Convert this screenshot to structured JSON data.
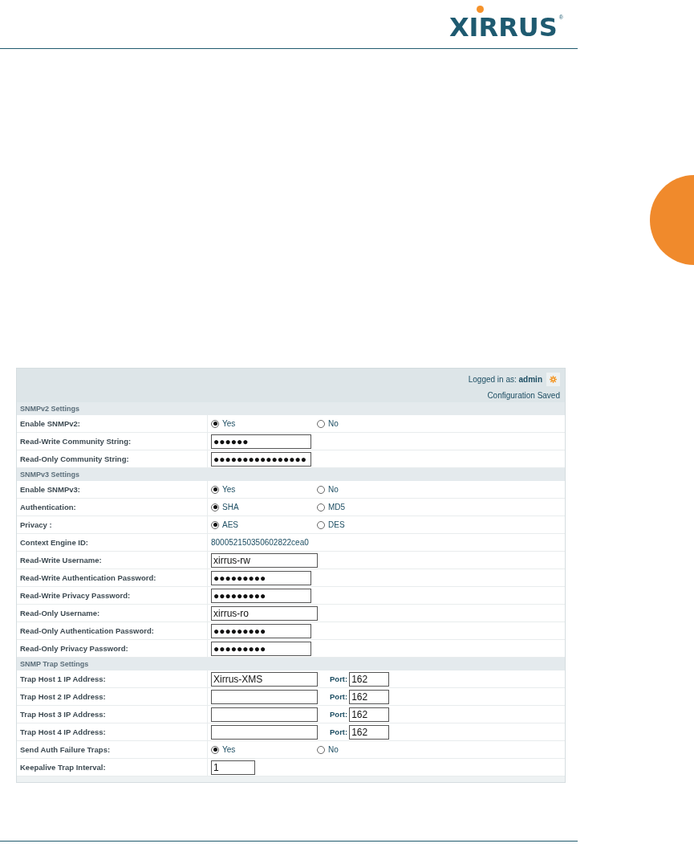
{
  "logo": {
    "text": "XIRRUS",
    "mark": "®"
  },
  "panel": {
    "login_label": "Logged in as:",
    "user": "admin",
    "status": "Configuration Saved"
  },
  "rows": [
    {
      "kind": "section",
      "label": "SNMPv2 Settings"
    },
    {
      "kind": "radio",
      "label": "Enable SNMPv2:",
      "options": [
        {
          "label": "Yes",
          "selected": true
        },
        {
          "label": "No",
          "selected": false
        }
      ]
    },
    {
      "kind": "password",
      "label": "Read-Write Community String:",
      "value": "●●●●●●"
    },
    {
      "kind": "password",
      "label": "Read-Only Community String:",
      "value": "●●●●●●●●●●●●●●●●"
    },
    {
      "kind": "section",
      "label": "SNMPv3 Settings"
    },
    {
      "kind": "radio",
      "label": "Enable SNMPv3:",
      "options": [
        {
          "label": "Yes",
          "selected": true
        },
        {
          "label": "No",
          "selected": false
        }
      ]
    },
    {
      "kind": "radio",
      "label": "Authentication:",
      "options": [
        {
          "label": "SHA",
          "selected": true
        },
        {
          "label": "MD5",
          "selected": false
        }
      ]
    },
    {
      "kind": "radio",
      "label": "Privacy :",
      "options": [
        {
          "label": "AES",
          "selected": true
        },
        {
          "label": "DES",
          "selected": false
        }
      ]
    },
    {
      "kind": "static",
      "label": "Context Engine ID:",
      "value": "800052150350602822cea0"
    },
    {
      "kind": "text",
      "label": "Read-Write Username:",
      "value": "xirrus-rw"
    },
    {
      "kind": "password",
      "label": "Read-Write Authentication Password:",
      "value": "●●●●●●●●●"
    },
    {
      "kind": "password",
      "label": "Read-Write Privacy Password:",
      "value": "●●●●●●●●●"
    },
    {
      "kind": "text",
      "label": "Read-Only Username:",
      "value": "xirrus-ro"
    },
    {
      "kind": "password",
      "label": "Read-Only Authentication Password:",
      "value": "●●●●●●●●●"
    },
    {
      "kind": "password",
      "label": "Read-Only Privacy Password:",
      "value": "●●●●●●●●●"
    },
    {
      "kind": "section",
      "label": "SNMP Trap Settings"
    },
    {
      "kind": "host",
      "label": "Trap Host 1 IP Address:",
      "value": "Xirrus-XMS",
      "port_label": "Port:",
      "port": "162"
    },
    {
      "kind": "host",
      "label": "Trap Host 2 IP Address:",
      "port_label": "Port:",
      "port": "162"
    },
    {
      "kind": "host",
      "label": "Trap Host 3 IP Address:",
      "port_label": "Port:",
      "port": "162"
    },
    {
      "kind": "host",
      "label": "Trap Host 4 IP Address:",
      "port_label": "Port:",
      "port": "162"
    },
    {
      "kind": "radio",
      "label": "Send Auth Failure Traps:",
      "options": [
        {
          "label": "Yes",
          "selected": true
        },
        {
          "label": "No",
          "selected": false
        }
      ]
    },
    {
      "kind": "short",
      "label": "Keepalive Trap Interval:",
      "value": "1"
    }
  ]
}
